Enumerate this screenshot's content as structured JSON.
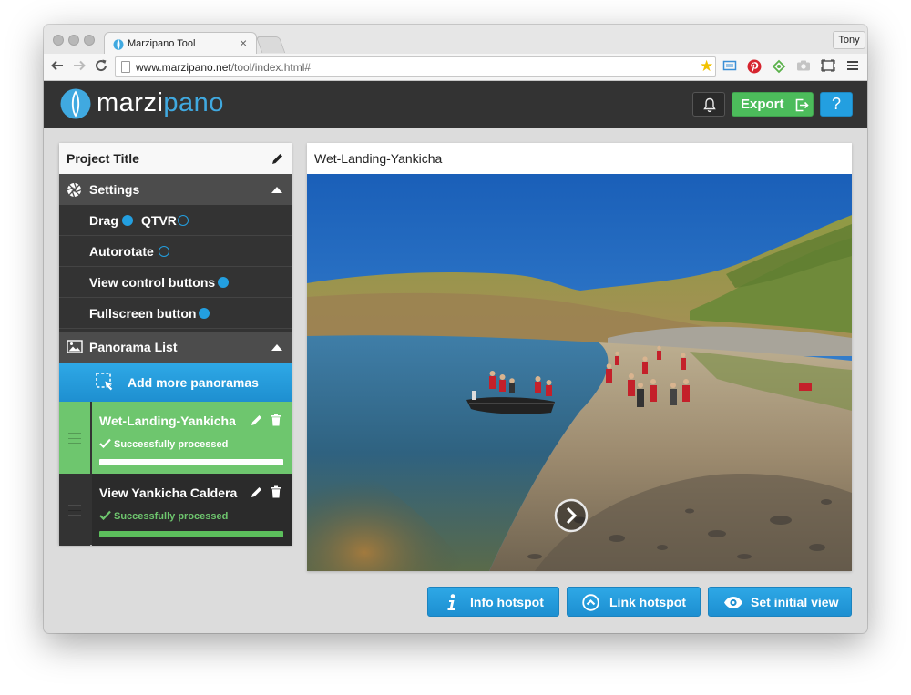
{
  "browser": {
    "tab_title": "Marzipano Tool",
    "tab_close": "×",
    "profile_name": "Tony",
    "url_host": "www.marzipano.net",
    "url_path": "/tool/index.html#"
  },
  "app": {
    "logo_part1": "marzi",
    "logo_part2": "pano",
    "export_label": "Export",
    "help_label": "?"
  },
  "sidebar": {
    "project_title": "Project Title",
    "settings_header": "Settings",
    "settings": {
      "drag_label": "Drag",
      "drag_on": true,
      "qtvr_label": "QTVR",
      "qtvr_on": false,
      "autorotate_label": "Autorotate",
      "autorotate_on": false,
      "view_control_label": "View control buttons",
      "view_control_on": true,
      "fullscreen_label": "Fullscreen button",
      "fullscreen_on": true
    },
    "panorama_header": "Panorama List",
    "add_label": "Add more panoramas",
    "panoramas": [
      {
        "name": "Wet-Landing-Yankicha",
        "status": "Successfully processed",
        "selected": true,
        "progress": 1.0
      },
      {
        "name": "View Yankicha Caldera",
        "status": "Successfully processed",
        "selected": false,
        "progress": 1.0
      }
    ]
  },
  "viewer": {
    "title": "Wet-Landing-Yankicha"
  },
  "actions": {
    "info_hotspot": "Info hotspot",
    "link_hotspot": "Link hotspot",
    "set_initial_view": "Set initial view"
  },
  "colors": {
    "accent_blue": "#239fe0",
    "success_green": "#6ec66e",
    "export_green": "#4cbc5b",
    "header_dark": "#333333"
  }
}
